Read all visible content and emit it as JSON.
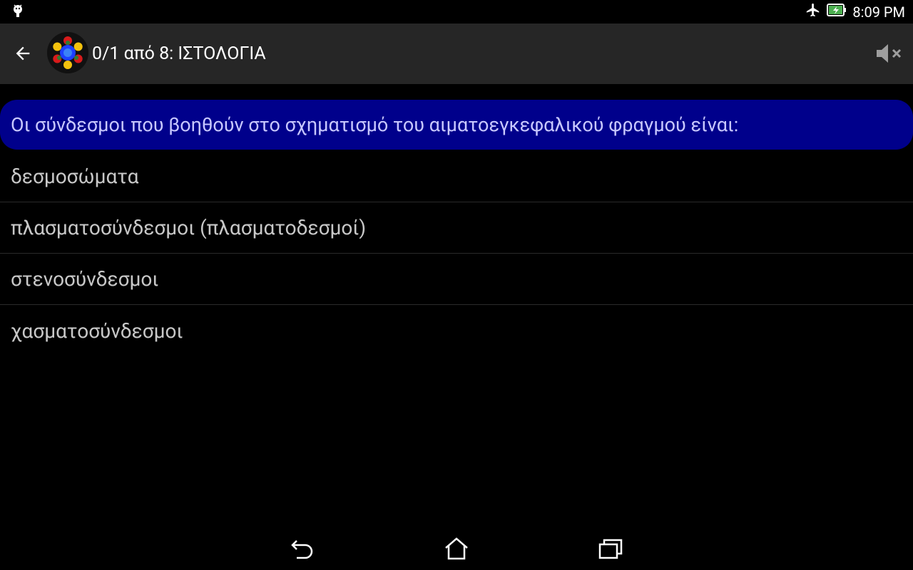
{
  "status_bar": {
    "left_icon": "android-debug-icon",
    "right_icons": [
      "airplane-icon",
      "battery-charging-icon"
    ],
    "time": "8:09 PM"
  },
  "app_bar": {
    "back_icon": "arrow-back-icon",
    "logo_icon": "app-logo-icon",
    "title": "0/1 από 8: ΙΣΤΟΛΟΓΙΑ",
    "mute_icon": "volume-mute-icon"
  },
  "question": {
    "text": "Οι σύνδεσμοι που βοηθούν στο σχηματισμό του αιματοεγκεφαλικού φραγμού είναι:"
  },
  "answers": [
    {
      "label": "δεσμοσώματα"
    },
    {
      "label": "πλασματοσύνδεσμοι (πλασματοδεσμοί)"
    },
    {
      "label": "στενοσύνδεσμοι"
    },
    {
      "label": "χασματοσύνδεσμοι"
    }
  ],
  "nav_bar": {
    "icons": [
      "back-nav-icon",
      "home-icon",
      "recents-icon"
    ]
  },
  "colors": {
    "app_bar_bg": "#262626",
    "question_bg": "#00008b",
    "question_text": "#c8c8ff",
    "answer_text": "#c8c8c8"
  }
}
